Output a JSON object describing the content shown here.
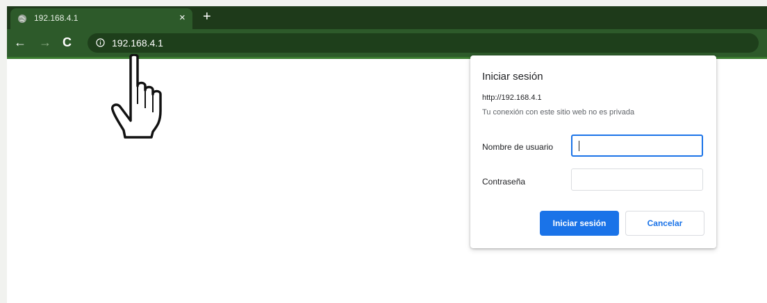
{
  "tab": {
    "title": "192.168.4.1",
    "close": "×",
    "new_tab": "+"
  },
  "toolbar": {
    "back": "←",
    "forward": "→",
    "reload": "C",
    "url": "192.168.4.1"
  },
  "dialog": {
    "title": "Iniciar sesión",
    "origin": "http://192.168.4.1",
    "warning": "Tu conexión con este sitio web no es privada",
    "username_label": "Nombre de usuario",
    "password_label": "Contraseña",
    "username_value": "",
    "password_value": "",
    "submit_label": "Iniciar sesión",
    "cancel_label": "Cancelar"
  },
  "colors": {
    "chrome_dark": "#1e3a1a",
    "chrome_toolbar": "#2d5a2a",
    "accent": "#1a73e8"
  },
  "icons": [
    "globe-icon",
    "info-icon",
    "pointing-hand-cursor-icon"
  ]
}
